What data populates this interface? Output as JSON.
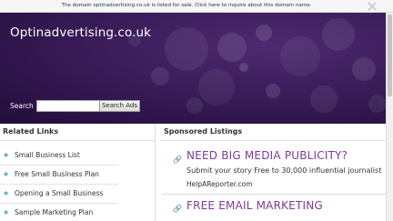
{
  "banner": {
    "text": "The domain optinadvertising.co.uk is listed for sale. Click here to inquire about this domain name."
  },
  "site": {
    "title": "Optinadvertising.co.uk"
  },
  "search": {
    "label": "Search",
    "input_value": "",
    "button_label": "Search Ads"
  },
  "related": {
    "heading": "Related Links",
    "links": [
      {
        "label": "Small Business List"
      },
      {
        "label": "Free Small Business Plan"
      },
      {
        "label": "Opening a Small Business"
      },
      {
        "label": "Sample Marketing Plan"
      }
    ]
  },
  "sponsored": {
    "heading": "Sponsored Listings",
    "listings": [
      {
        "title": "NEED BIG MEDIA PUBLICITY?",
        "description": "Submit your story Free to 30,000 influential journalist",
        "url": "HelpAReporter.com"
      },
      {
        "title": "FREE EMAIL MARKETING"
      }
    ]
  },
  "colors": {
    "hero_background": "#3a1c59",
    "ad_title": "#7e3b97",
    "star_icon": "#4aa3d8"
  }
}
